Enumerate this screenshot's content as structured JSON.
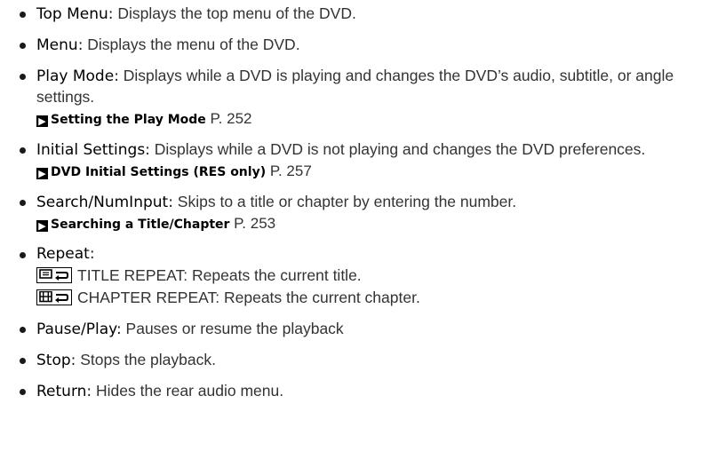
{
  "items": [
    {
      "term": "Top Menu",
      "sep": ":",
      "desc": " Displays the top menu of the DVD."
    },
    {
      "term": "Menu",
      "sep": ":",
      "desc": " Displays the menu of the DVD."
    },
    {
      "term": "Play Mode",
      "sep": ":",
      "desc": " Displays while a DVD is playing and changes the DVD’s audio, subtitle, or angle settings.",
      "ref_title": "Setting the Play Mode",
      "ref_page": " P. 252"
    },
    {
      "term": "Initial Settings",
      "sep": ":",
      "desc": " Displays while a DVD is not playing and changes the DVD preferences.",
      "ref_title": "DVD Initial Settings (RES only)",
      "ref_page": " P. 257"
    },
    {
      "term": "Search/NumInput",
      "sep": ":",
      "desc": " Skips to a title or chapter by entering the number.",
      "ref_title": "Searching a Title/Chapter",
      "ref_page": " P. 253"
    },
    {
      "term": "Repeat",
      "sep": ":",
      "sub1": "TITLE REPEAT: Repeats the current title.",
      "sub2": "CHAPTER REPEAT: Repeats the current chapter."
    },
    {
      "term": "Pause/Play",
      "sep": ":",
      "desc": " Pauses or resume the playback"
    },
    {
      "term": "Stop",
      "sep": ":",
      "desc": " Stops the playback."
    },
    {
      "term": "Return",
      "sep": ":",
      "desc": " Hides the rear audio menu."
    }
  ],
  "icons": {
    "ref": "arrow-right-icon",
    "title_repeat": "title-repeat-icon",
    "chapter_repeat": "chapter-repeat-icon"
  }
}
